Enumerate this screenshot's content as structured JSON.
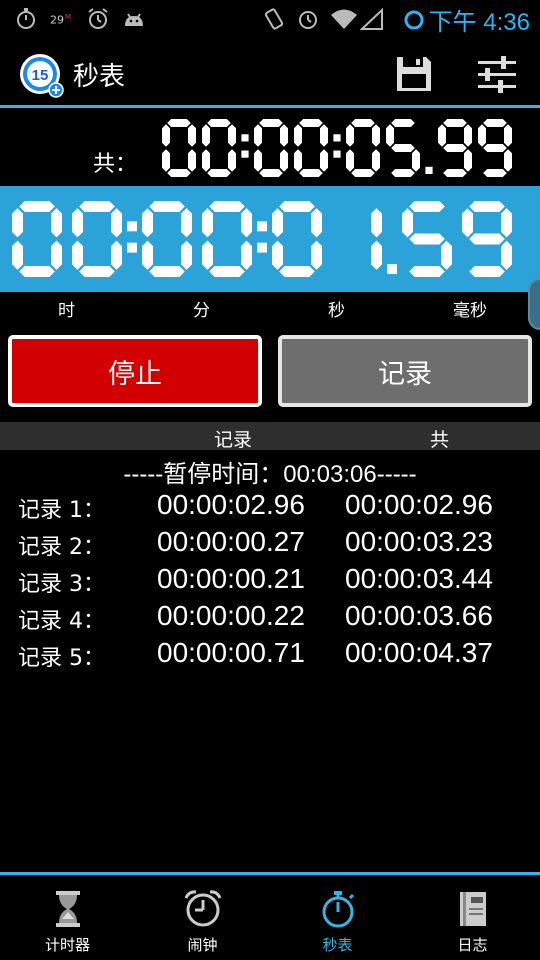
{
  "status_bar": {
    "notification_count": "29",
    "notification_badge": "M",
    "time": "下午 4:36",
    "accent_color": "#29b6f6"
  },
  "action_bar": {
    "app_badge_number": "15",
    "title": "秒表",
    "icons": [
      "app-logo-icon",
      "save-icon",
      "settings-sliders-icon"
    ]
  },
  "total_time": {
    "label": "共：",
    "hours": "00",
    "minutes": "00",
    "seconds": "05",
    "hundredths": "99"
  },
  "lap_time": {
    "hours": "00",
    "minutes": "00",
    "seconds": "01",
    "hundredths": "59",
    "background_color": "#2ba3d8"
  },
  "units": {
    "hours": "时",
    "minutes": "分",
    "seconds": "秒",
    "hundredths": "毫秒"
  },
  "buttons": {
    "stop": "停止",
    "lap": "记录",
    "stop_color": "#d20000",
    "lap_color": "#6e6e6e"
  },
  "list_header": {
    "lap": "记录",
    "total": "共"
  },
  "pause_line": "-----暂停时间：00:03:06-----",
  "laps": [
    {
      "name": "记录 1：",
      "split": "00:00:02.96",
      "total": "00:00:02.96"
    },
    {
      "name": "记录 2：",
      "split": "00:00:00.27",
      "total": "00:00:03.23"
    },
    {
      "name": "记录 3：",
      "split": "00:00:00.21",
      "total": "00:00:03.44"
    },
    {
      "name": "记录 4：",
      "split": "00:00:00.22",
      "total": "00:00:03.66"
    },
    {
      "name": "记录 5：",
      "split": "00:00:00.71",
      "total": "00:00:04.37"
    }
  ],
  "bottom_nav": {
    "items": [
      {
        "label": "计时器",
        "icon": "hourglass-icon"
      },
      {
        "label": "闹钟",
        "icon": "alarm-clock-icon"
      },
      {
        "label": "秒表",
        "icon": "stopwatch-icon",
        "active": true
      },
      {
        "label": "日志",
        "icon": "log-book-icon"
      }
    ],
    "active_color": "#33b5e5"
  }
}
